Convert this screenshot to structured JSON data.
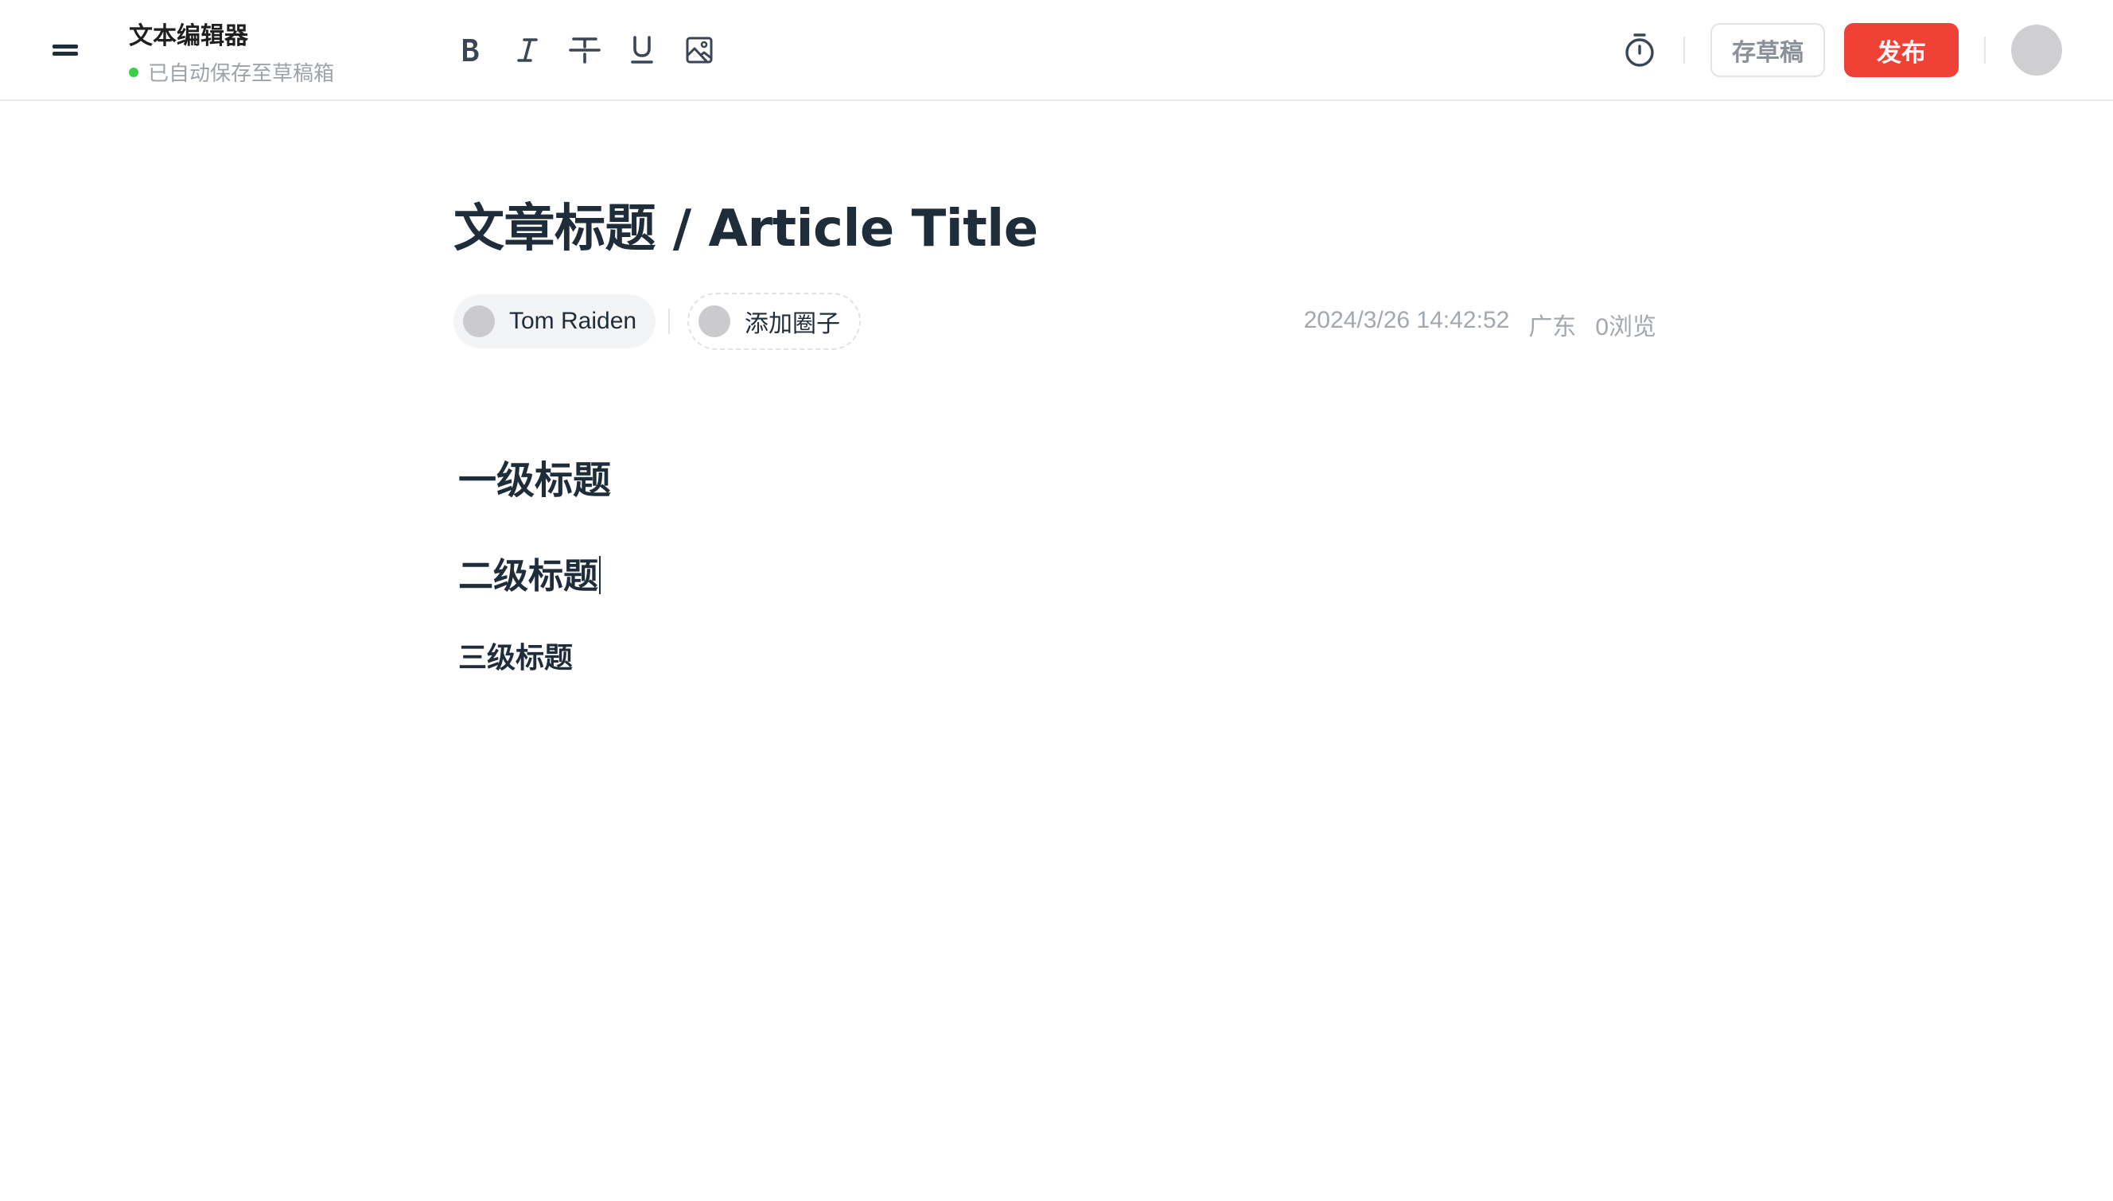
{
  "header": {
    "app_title": "文本编辑器",
    "save_status": "已自动保存至草稿箱",
    "status_color": "#36d046",
    "toolbar": [
      {
        "name": "bold-button",
        "icon": "bold-icon"
      },
      {
        "name": "italic-button",
        "icon": "italic-icon"
      },
      {
        "name": "strikethrough-button",
        "icon": "strikethrough-icon"
      },
      {
        "name": "underline-button",
        "icon": "underline-icon"
      },
      {
        "name": "insert-image-button",
        "icon": "image-icon"
      }
    ],
    "timer_icon": "timer-icon",
    "draft_label": "存草稿",
    "publish_label": "发布",
    "publish_color": "#f04137"
  },
  "article": {
    "title": "文章标题 / Article Title",
    "author": "Tom Raiden",
    "add_circle_label": "添加圈子",
    "datetime": "2024/3/26 14:42:52",
    "location": "广东",
    "views": "0浏览"
  },
  "body": {
    "heading1": "一级标题",
    "heading2": "二级标题",
    "heading3": "三级标题"
  }
}
